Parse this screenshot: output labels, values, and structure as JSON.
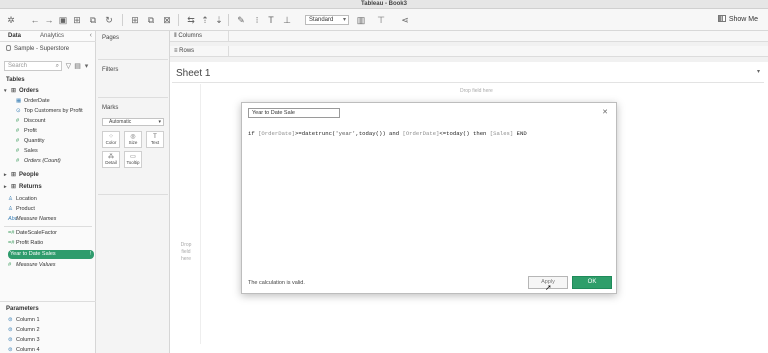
{
  "window": {
    "title": "Tableau - Book3"
  },
  "toolbar": {
    "view_select": "Standard",
    "show_me": "Show Me"
  },
  "data_pane": {
    "tab_data": "Data",
    "tab_analytics": "Analytics",
    "datasource": "Sample - Superstore",
    "search_placeholder": "Search",
    "tables_header": "Tables",
    "orders": "Orders",
    "orders_fields": [
      "OrderDate",
      "Top Customers by Profit",
      "Discount",
      "Profit",
      "Quantity",
      "Sales",
      "Orders (Count)"
    ],
    "people": "People",
    "returns": "Returns",
    "other_fields": [
      "Location",
      "Product",
      "Measure Names",
      "DateScaleFactor",
      "Profit Ratio"
    ],
    "selected_field": "Year to Date Sales",
    "measure_values": "Measure Values",
    "parameters_header": "Parameters",
    "parameters": [
      "Column 1",
      "Column 2",
      "Column 3",
      "Column 4"
    ]
  },
  "cards": {
    "pages": "Pages",
    "filters": "Filters",
    "marks": "Marks",
    "marks_type": "Automatic",
    "mark_buttons": [
      "Color",
      "Size",
      "Text",
      "Detail",
      "Tooltip"
    ]
  },
  "shelves": {
    "columns": "Columns",
    "rows": "Rows"
  },
  "sheet": {
    "title": "Sheet 1",
    "drop_field_here": "Drop field here",
    "drop_vertical": "Drop field here"
  },
  "calc_dialog": {
    "name": "Year to Date Sale",
    "formula_parts": {
      "p1": "if ",
      "f1": "[OrderDate]",
      "p2": ">=datetrunc(",
      "s1": "'year'",
      "p3": ",today()) and ",
      "f2": "[OrderDate]",
      "p4": "<=today() then ",
      "f3": "[Sales]",
      "p5": " END"
    },
    "status": "The calculation is valid.",
    "apply": "Apply",
    "ok": "OK"
  }
}
